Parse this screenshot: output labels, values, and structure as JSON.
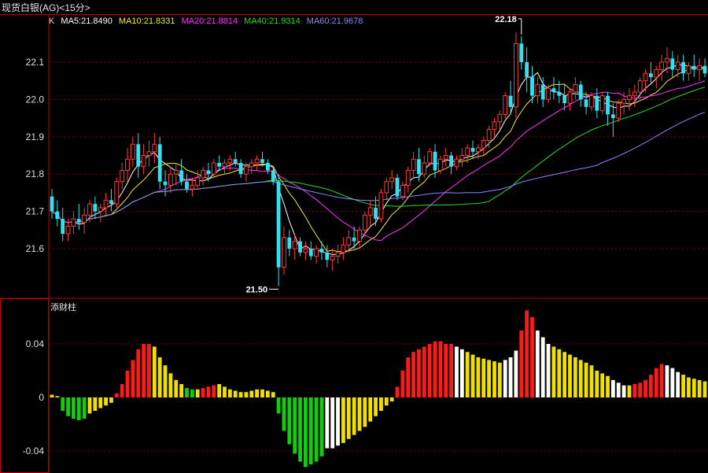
{
  "window": {
    "title": "现货白银(AG)<15分>"
  },
  "legend": {
    "prefix": "K",
    "ma": [
      {
        "label": "MA5:21.8490",
        "color": "#ffffff"
      },
      {
        "label": "MA10:21.8331",
        "color": "#f5e63b"
      },
      {
        "label": "MA20:21.8814",
        "color": "#ff33ff"
      },
      {
        "label": "MA40:21.9314",
        "color": "#22dd22"
      },
      {
        "label": "MA60:21.9678",
        "color": "#8888ff"
      }
    ]
  },
  "indicator_panel": {
    "label": "添财柱"
  },
  "colors": {
    "background": "#000000",
    "border": "#c00000",
    "grid": "#7a0000",
    "up_candle": "#ff3c3c",
    "down_candle": "#33e0f0",
    "hist_red": "#ff1a1a",
    "hist_white": "#ffffff",
    "hist_yellow": "#f0e000",
    "hist_green": "#11cc11",
    "axis_text": "#dddddd"
  },
  "chart_data": [
    {
      "type": "candlestick",
      "title": "现货白银(AG)<15分>",
      "y_ticks": [
        "21.6",
        "21.7",
        "21.8",
        "21.9",
        "22.0",
        "22.1"
      ],
      "ylim": [
        21.5,
        22.2
      ],
      "grid": true,
      "annotations": [
        {
          "text": "22.18",
          "kind": "high",
          "bar_index": 87
        },
        {
          "text": "21.50",
          "kind": "low",
          "bar_index": 42
        }
      ],
      "ohlc": [
        [
          21.74,
          21.76,
          21.68,
          21.7
        ],
        [
          21.7,
          21.73,
          21.66,
          21.68
        ],
        [
          21.68,
          21.71,
          21.62,
          21.64
        ],
        [
          21.64,
          21.68,
          21.62,
          21.66
        ],
        [
          21.66,
          21.7,
          21.64,
          21.68
        ],
        [
          21.68,
          21.72,
          21.65,
          21.67
        ],
        [
          21.67,
          21.71,
          21.64,
          21.69
        ],
        [
          21.69,
          21.73,
          21.67,
          21.72
        ],
        [
          21.72,
          21.74,
          21.68,
          21.7
        ],
        [
          21.7,
          21.72,
          21.67,
          21.71
        ],
        [
          21.71,
          21.75,
          21.69,
          21.73
        ],
        [
          21.73,
          21.76,
          21.7,
          21.72
        ],
        [
          21.72,
          21.79,
          21.71,
          21.78
        ],
        [
          21.78,
          21.83,
          21.76,
          21.81
        ],
        [
          21.81,
          21.87,
          21.78,
          21.84
        ],
        [
          21.84,
          21.9,
          21.82,
          21.88
        ],
        [
          21.88,
          21.91,
          21.79,
          21.82
        ],
        [
          21.82,
          21.88,
          21.8,
          21.85
        ],
        [
          21.85,
          21.89,
          21.82,
          21.86
        ],
        [
          21.86,
          21.91,
          21.83,
          21.88
        ],
        [
          21.88,
          21.9,
          21.76,
          21.78
        ],
        [
          21.78,
          21.81,
          21.74,
          21.77
        ],
        [
          21.77,
          21.82,
          21.75,
          21.8
        ],
        [
          21.8,
          21.83,
          21.77,
          21.81
        ],
        [
          21.81,
          21.84,
          21.77,
          21.78
        ],
        [
          21.78,
          21.8,
          21.75,
          21.76
        ],
        [
          21.76,
          21.79,
          21.74,
          21.77
        ],
        [
          21.77,
          21.81,
          21.76,
          21.79
        ],
        [
          21.79,
          21.82,
          21.77,
          21.81
        ],
        [
          21.81,
          21.83,
          21.78,
          21.8
        ],
        [
          21.8,
          21.84,
          21.79,
          21.83
        ],
        [
          21.83,
          21.85,
          21.81,
          21.82
        ],
        [
          21.82,
          21.84,
          21.8,
          21.83
        ],
        [
          21.83,
          21.85,
          21.81,
          21.84
        ],
        [
          21.84,
          21.86,
          21.82,
          21.83
        ],
        [
          21.83,
          21.84,
          21.79,
          21.8
        ],
        [
          21.8,
          21.83,
          21.78,
          21.82
        ],
        [
          21.82,
          21.84,
          21.8,
          21.83
        ],
        [
          21.83,
          21.85,
          21.81,
          21.84
        ],
        [
          21.84,
          21.86,
          21.82,
          21.83
        ],
        [
          21.83,
          21.84,
          21.8,
          21.81
        ],
        [
          21.81,
          21.82,
          21.77,
          21.78
        ],
        [
          21.78,
          21.8,
          21.5,
          21.55
        ],
        [
          21.55,
          21.66,
          21.53,
          21.63
        ],
        [
          21.63,
          21.65,
          21.58,
          21.6
        ],
        [
          21.6,
          21.64,
          21.57,
          21.62
        ],
        [
          21.62,
          21.63,
          21.58,
          21.59
        ],
        [
          21.59,
          21.62,
          21.57,
          21.6
        ],
        [
          21.6,
          21.62,
          21.57,
          21.58
        ],
        [
          21.58,
          21.61,
          21.56,
          21.6
        ],
        [
          21.6,
          21.62,
          21.57,
          21.59
        ],
        [
          21.59,
          21.61,
          21.55,
          21.57
        ],
        [
          21.57,
          21.6,
          21.54,
          21.58
        ],
        [
          21.58,
          21.61,
          21.56,
          21.59
        ],
        [
          21.59,
          21.63,
          21.57,
          21.61
        ],
        [
          21.61,
          21.65,
          21.59,
          21.63
        ],
        [
          21.63,
          21.66,
          21.6,
          21.62
        ],
        [
          21.62,
          21.66,
          21.6,
          21.65
        ],
        [
          21.65,
          21.7,
          21.63,
          21.69
        ],
        [
          21.69,
          21.73,
          21.66,
          21.71
        ],
        [
          21.71,
          21.74,
          21.66,
          21.68
        ],
        [
          21.68,
          21.76,
          21.67,
          21.75
        ],
        [
          21.75,
          21.79,
          21.73,
          21.78
        ],
        [
          21.78,
          21.81,
          21.76,
          21.79
        ],
        [
          21.79,
          21.8,
          21.73,
          21.74
        ],
        [
          21.74,
          21.78,
          21.73,
          21.77
        ],
        [
          21.77,
          21.82,
          21.75,
          21.81
        ],
        [
          21.81,
          21.86,
          21.79,
          21.84
        ],
        [
          21.84,
          21.87,
          21.78,
          21.8
        ],
        [
          21.8,
          21.85,
          21.79,
          21.83
        ],
        [
          21.83,
          21.87,
          21.82,
          21.86
        ],
        [
          21.86,
          21.88,
          21.79,
          21.81
        ],
        [
          21.81,
          21.85,
          21.8,
          21.84
        ],
        [
          21.84,
          21.87,
          21.82,
          21.85
        ],
        [
          21.85,
          21.86,
          21.8,
          21.82
        ],
        [
          21.82,
          21.85,
          21.81,
          21.84
        ],
        [
          21.84,
          21.87,
          21.82,
          21.85
        ],
        [
          21.85,
          21.88,
          21.83,
          21.87
        ],
        [
          21.87,
          21.89,
          21.84,
          21.86
        ],
        [
          21.86,
          21.88,
          21.84,
          21.87
        ],
        [
          21.87,
          21.9,
          21.85,
          21.89
        ],
        [
          21.89,
          21.93,
          21.87,
          21.92
        ],
        [
          21.92,
          21.95,
          21.9,
          21.94
        ],
        [
          21.94,
          21.97,
          21.92,
          21.96
        ],
        [
          21.96,
          22.02,
          21.95,
          22.01
        ],
        [
          22.01,
          22.05,
          21.96,
          21.98
        ],
        [
          21.98,
          22.18,
          21.95,
          22.15
        ],
        [
          22.15,
          22.17,
          22.08,
          22.1
        ],
        [
          22.1,
          22.14,
          22.02,
          22.06
        ],
        [
          22.06,
          22.09,
          21.99,
          22.01
        ],
        [
          22.01,
          22.06,
          21.99,
          22.04
        ],
        [
          22.04,
          22.06,
          21.98,
          22.0
        ],
        [
          22.0,
          22.04,
          21.99,
          22.03
        ],
        [
          22.03,
          22.06,
          22.0,
          22.02
        ],
        [
          22.02,
          22.05,
          21.99,
          22.01
        ],
        [
          22.01,
          22.04,
          21.97,
          21.99
        ],
        [
          21.99,
          22.03,
          21.97,
          22.02
        ],
        [
          22.02,
          22.06,
          22.0,
          22.04
        ],
        [
          22.04,
          22.05,
          21.98,
          22.0
        ],
        [
          22.0,
          22.02,
          21.96,
          21.98
        ],
        [
          21.98,
          22.02,
          21.97,
          22.01
        ],
        [
          22.01,
          22.03,
          21.95,
          21.97
        ],
        [
          21.97,
          22.02,
          21.96,
          22.01
        ],
        [
          22.01,
          22.02,
          21.93,
          21.96
        ],
        [
          21.96,
          21.99,
          21.9,
          21.95
        ],
        [
          21.95,
          22.0,
          21.94,
          21.99
        ],
        [
          21.99,
          22.02,
          21.96,
          22.0
        ],
        [
          22.0,
          22.03,
          21.97,
          22.01
        ],
        [
          22.01,
          22.04,
          21.98,
          22.02
        ],
        [
          22.02,
          22.06,
          22.0,
          22.05
        ],
        [
          22.05,
          22.08,
          22.02,
          22.07
        ],
        [
          22.07,
          22.1,
          22.04,
          22.06
        ],
        [
          22.06,
          22.09,
          22.03,
          22.08
        ],
        [
          22.08,
          22.12,
          22.05,
          22.1
        ],
        [
          22.1,
          22.14,
          22.07,
          22.11
        ],
        [
          22.11,
          22.13,
          22.06,
          22.08
        ],
        [
          22.08,
          22.12,
          22.06,
          22.1
        ],
        [
          22.1,
          22.12,
          22.05,
          22.07
        ],
        [
          22.07,
          22.1,
          22.05,
          22.09
        ],
        [
          22.09,
          22.12,
          22.06,
          22.08
        ],
        [
          22.08,
          22.11,
          22.05,
          22.09
        ],
        [
          22.09,
          22.11,
          22.06,
          22.07
        ]
      ]
    },
    {
      "type": "bar",
      "title": "添财柱",
      "y_ticks": [
        "0.04",
        "0",
        "-0.04"
      ],
      "ylim": [
        -0.053,
        0.07
      ],
      "grid": true,
      "values": [
        0.002,
        0.001,
        -0.01,
        -0.014,
        -0.016,
        -0.017,
        -0.016,
        -0.012,
        -0.01,
        -0.008,
        -0.006,
        -0.004,
        0.003,
        0.01,
        0.02,
        0.028,
        0.036,
        0.04,
        0.04,
        0.038,
        0.03,
        0.024,
        0.018,
        0.013,
        0.01,
        0.007,
        0.006,
        0.006,
        0.007,
        0.008,
        0.009,
        0.01,
        0.008,
        0.006,
        0.005,
        0.004,
        0.004,
        0.005,
        0.006,
        0.006,
        0.005,
        0.004,
        -0.012,
        -0.025,
        -0.035,
        -0.042,
        -0.048,
        -0.052,
        -0.05,
        -0.048,
        -0.044,
        -0.038,
        -0.038,
        -0.036,
        -0.034,
        -0.031,
        -0.028,
        -0.025,
        -0.022,
        -0.018,
        -0.014,
        -0.01,
        -0.006,
        -0.003,
        0.008,
        0.02,
        0.03,
        0.034,
        0.036,
        0.038,
        0.04,
        0.042,
        0.042,
        0.04,
        0.04,
        0.038,
        0.036,
        0.034,
        0.032,
        0.03,
        0.029,
        0.028,
        0.027,
        0.026,
        0.028,
        0.03,
        0.035,
        0.05,
        0.065,
        0.06,
        0.05,
        0.045,
        0.04,
        0.038,
        0.036,
        0.034,
        0.032,
        0.03,
        0.028,
        0.026,
        0.024,
        0.02,
        0.018,
        0.016,
        0.013,
        0.011,
        0.009,
        0.009,
        0.01,
        0.011,
        0.013,
        0.017,
        0.022,
        0.025,
        0.024,
        0.022,
        0.019,
        0.017,
        0.015,
        0.014,
        0.013,
        0.012
      ],
      "colors": [
        "y",
        "y",
        "g",
        "g",
        "g",
        "g",
        "g",
        "y",
        "y",
        "y",
        "y",
        "y",
        "r",
        "r",
        "r",
        "r",
        "r",
        "r",
        "r",
        "y",
        "y",
        "y",
        "y",
        "y",
        "y",
        "g",
        "g",
        "y",
        "r",
        "r",
        "r",
        "y",
        "y",
        "y",
        "y",
        "y",
        "y",
        "y",
        "y",
        "y",
        "y",
        "y",
        "g",
        "g",
        "g",
        "g",
        "g",
        "g",
        "g",
        "g",
        "g",
        "w",
        "w",
        "w",
        "y",
        "y",
        "y",
        "y",
        "y",
        "y",
        "y",
        "y",
        "y",
        "y",
        "r",
        "r",
        "r",
        "r",
        "r",
        "r",
        "r",
        "r",
        "r",
        "r",
        "r",
        "w",
        "w",
        "y",
        "y",
        "y",
        "y",
        "y",
        "y",
        "y",
        "w",
        "w",
        "w",
        "r",
        "r",
        "r",
        "w",
        "w",
        "w",
        "y",
        "y",
        "y",
        "y",
        "y",
        "y",
        "y",
        "y",
        "y",
        "y",
        "y",
        "w",
        "w",
        "w",
        "y",
        "r",
        "r",
        "r",
        "r",
        "r",
        "r",
        "w",
        "w",
        "w",
        "y",
        "y",
        "y",
        "y",
        "y"
      ]
    }
  ]
}
